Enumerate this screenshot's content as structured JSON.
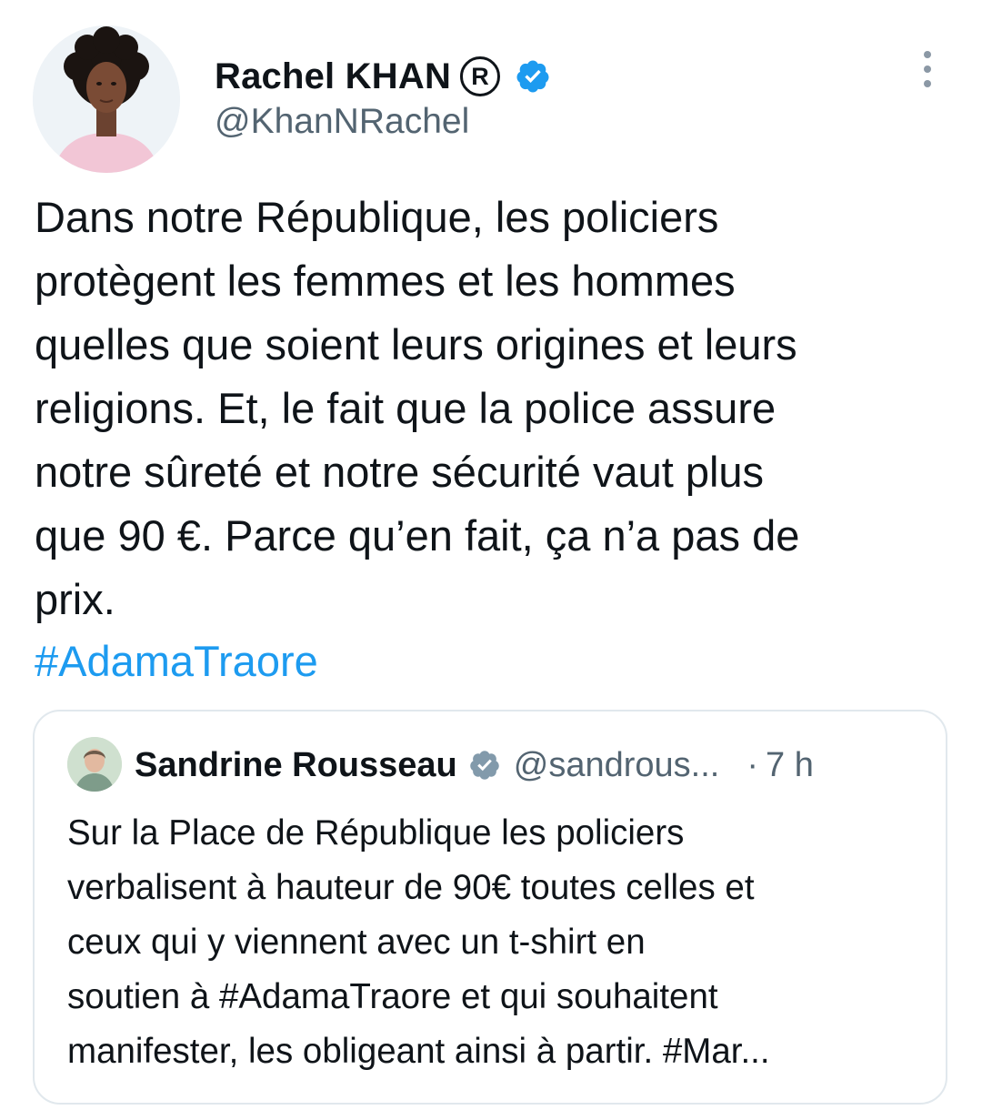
{
  "tweet": {
    "author": {
      "name": "Rachel KHAN",
      "registered_mark": "R",
      "handle": "@KhanNRachel",
      "verified": true,
      "avatar": "portrait-woman-curly-hair"
    },
    "text": "Dans notre République, les policiers\nprotègent les femmes et les hommes\nquelles que soient leurs origines et leurs\nreligions. Et, le fait que la police assure\nnotre sûreté et notre sécurité vaut plus\nque 90 €. Parce qu’en fait, ça n’a pas de\nprix.",
    "hashtag": "#AdamaTraore",
    "more_icon": "more-vertical-icon"
  },
  "quoted": {
    "author": {
      "name": "Sandrine Rousseau",
      "handle": "@sandrous...",
      "verified": true,
      "avatar": "portrait-woman-short-hair"
    },
    "separator": "·",
    "time": "7 h",
    "text": "Sur la Place de République les policiers\nverbalisent à hauteur de 90€ toutes celles et\nceux qui y viennent avec un t-shirt en\nsoutien à #AdamaTraore et qui souhaitent\nmanifester, les obligeant ainsi à partir. #Mar..."
  },
  "colors": {
    "link": "#1d9bf0",
    "secondary_text": "#536471",
    "verified_blue": "#1d9bf0",
    "verified_gray": "#829aab",
    "border": "#e1e8ed"
  }
}
